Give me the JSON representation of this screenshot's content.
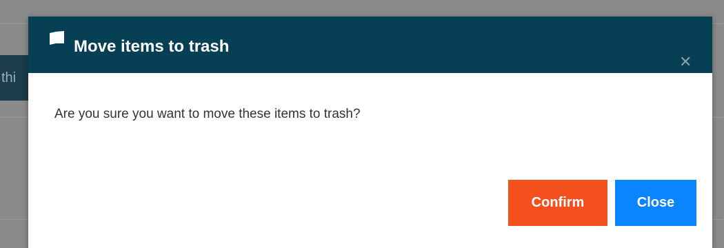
{
  "background": {
    "partial_text": "thi"
  },
  "dialog": {
    "title": "Move items to trash",
    "title_icon": "flag-icon",
    "close_icon": "close-icon",
    "close_glyph": "✕",
    "message": "Are you sure you want to move these items to trash?",
    "buttons": {
      "confirm_label": "Confirm",
      "close_label": "Close"
    }
  },
  "colors": {
    "header_bg": "#073f54",
    "confirm_bg": "#f4511e",
    "close_bg": "#0a84ff",
    "overlay": "#8a8a8a"
  }
}
